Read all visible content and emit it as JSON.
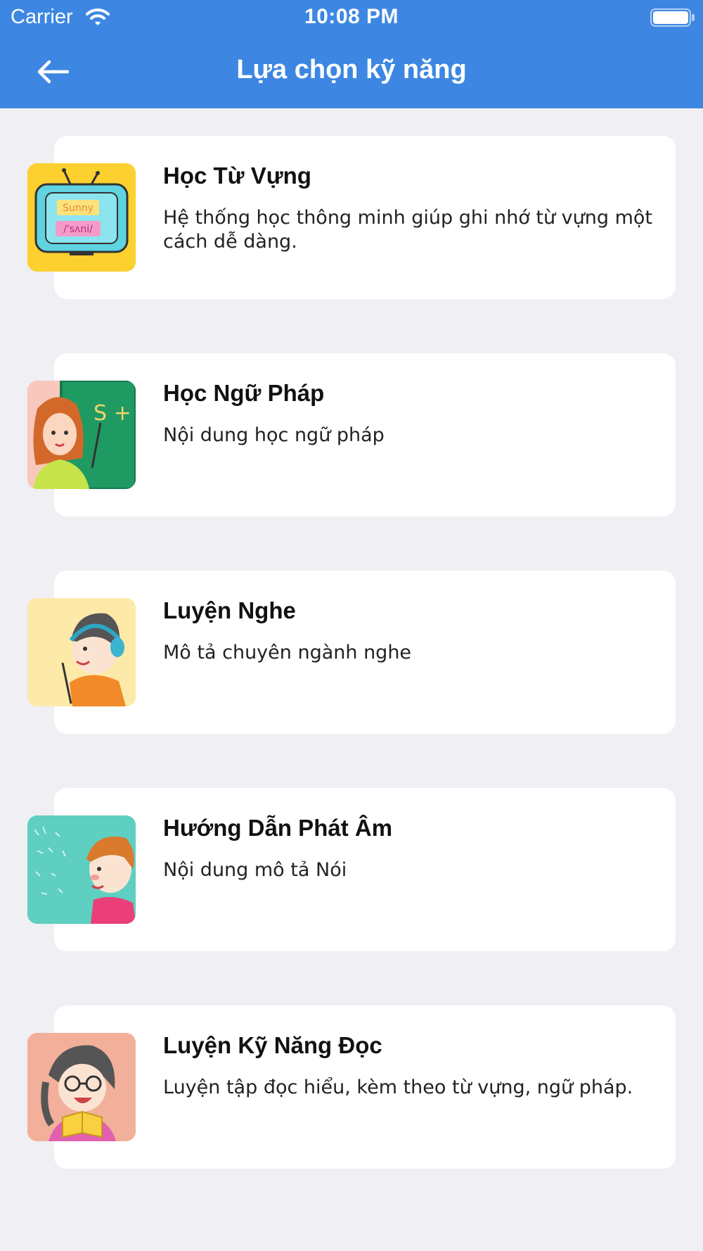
{
  "status_bar": {
    "carrier": "Carrier",
    "time": "10:08 PM",
    "icons": [
      "wifi-icon",
      "battery-icon"
    ]
  },
  "header": {
    "title": "Lựa chọn kỹ năng",
    "back_icon": "arrow-left-icon",
    "background": "#3d87e2"
  },
  "skills": [
    {
      "title": "Học Từ Vựng",
      "description": "Hệ thống học thông minh giúp ghi nhớ từ vựng một cách dễ dàng.",
      "image": "tv-vocabulary-illustration",
      "tv_word": "Sunny",
      "tv_phonetic": "/'sʌni/",
      "thumb_bg": "#fcd02f"
    },
    {
      "title": "Học Ngữ Pháp",
      "description": "Nội dung học ngữ pháp",
      "image": "teacher-blackboard-illustration",
      "board_text": "S + V",
      "thumb_bg": "#f8c8bc"
    },
    {
      "title": "Luyện Nghe",
      "description": "Mô tả chuyên ngành nghe",
      "image": "boy-headphones-illustration",
      "thumb_bg": "#fde9a8"
    },
    {
      "title": "Hướng Dẫn Phát Âm",
      "description": "Nội dung mô tả Nói",
      "image": "boy-phonetics-illustration",
      "thumb_bg": "#5ecfc0"
    },
    {
      "title": "Luyện Kỹ Năng Đọc",
      "description": "Luyện tập đọc hiểu, kèm theo từ vựng, ngữ pháp.",
      "image": "girl-reading-book-illustration",
      "thumb_bg": "#f2b09a"
    }
  ]
}
